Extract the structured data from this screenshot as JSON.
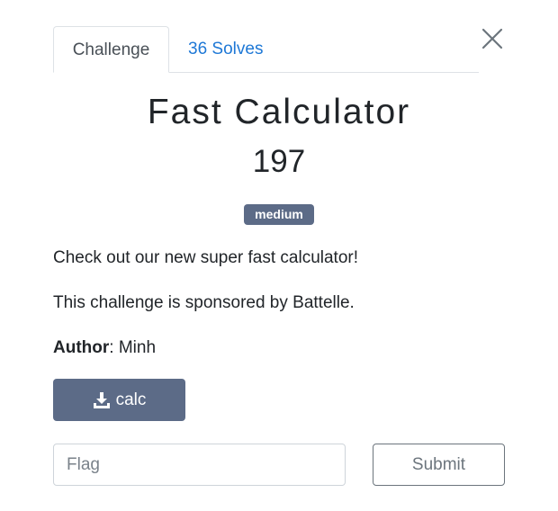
{
  "tabs": {
    "challenge": "Challenge",
    "solves": "36 Solves"
  },
  "challenge": {
    "name": "Fast Calculator",
    "points": "197",
    "difficulty": "medium",
    "description": [
      "Check out our new super fast calculator!",
      "This challenge is sponsored by Battelle."
    ],
    "author_label": "Author",
    "author_sep": ": ",
    "author_name": "Minh"
  },
  "files": [
    {
      "label": "calc",
      "icon": "download-icon"
    }
  ],
  "flag_form": {
    "placeholder": "Flag",
    "value": "",
    "submit_label": "Submit"
  },
  "icons": {
    "close": "close-icon"
  },
  "colors": {
    "badge": "#5c6b87",
    "link": "#1e78d6",
    "button_primary": "#5c6b87",
    "button_outline": "#6c757d"
  }
}
